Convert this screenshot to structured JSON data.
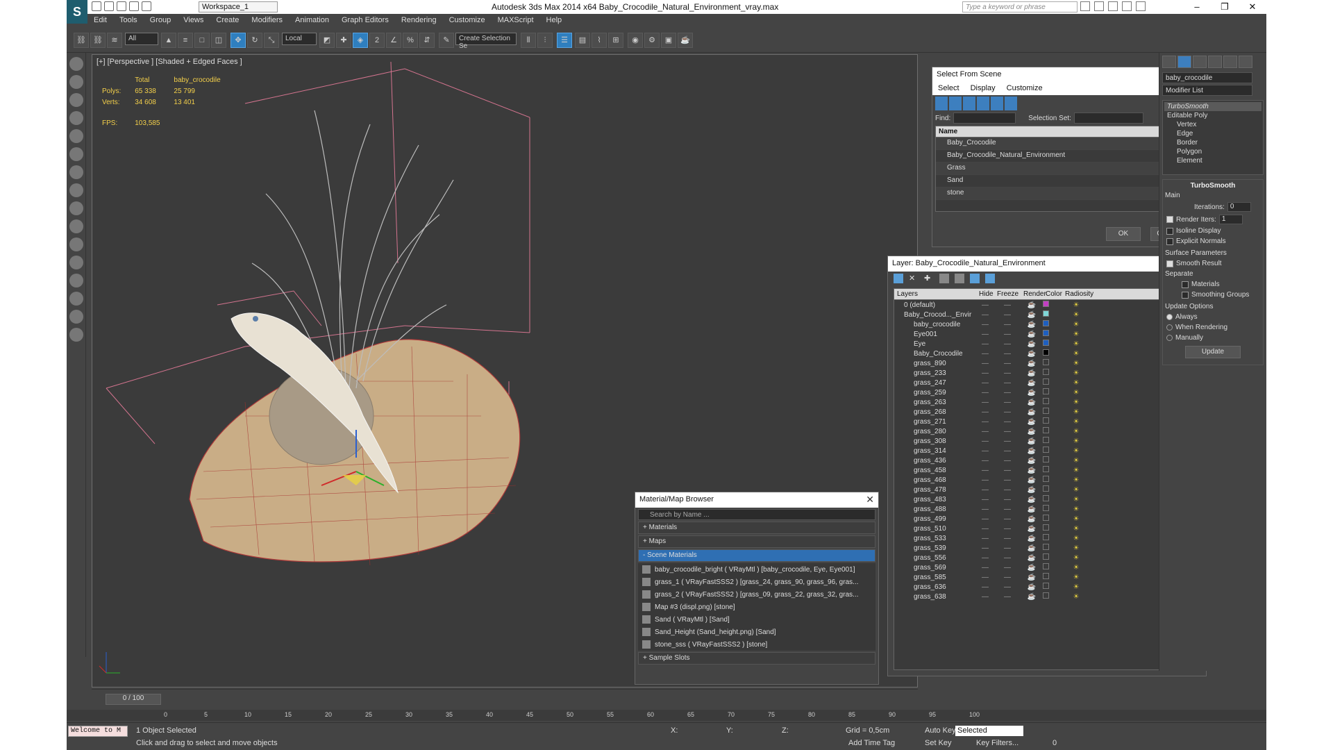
{
  "titlebar": {
    "title": "Autodesk 3ds Max  2014 x64    Baby_Crocodile_Natural_Environment_vray.max",
    "workspace": "Workspace_1",
    "search_placeholder": "Type a keyword or phrase"
  },
  "menu": [
    "Edit",
    "Tools",
    "Group",
    "Views",
    "Create",
    "Modifiers",
    "Animation",
    "Graph Editors",
    "Rendering",
    "Customize",
    "MAXScript",
    "Help"
  ],
  "toolbar": {
    "filter": "All",
    "refcoord": "Local",
    "selset": "Create Selection Se"
  },
  "viewport": {
    "label": "[+] [Perspective ] [Shaded + Edged Faces ]",
    "stats_total": "Total",
    "stats_obj": "baby_crocodile",
    "polys_label": "Polys:",
    "polys_total": "65 338",
    "polys_obj": "25 799",
    "verts_label": "Verts:",
    "verts_total": "34 608",
    "verts_obj": "13 401",
    "fps_label": "FPS:",
    "fps_value": "103,585"
  },
  "select_from_scene": {
    "title": "Select From Scene",
    "menu": [
      "Select",
      "Display",
      "Customize"
    ],
    "find_label": "Find:",
    "selset_label": "Selection Set:",
    "col_name": "Name",
    "items": [
      "Baby_Crocodile",
      "Baby_Crocodile_Natural_Environment",
      "Grass",
      "Sand",
      "stone"
    ],
    "ok": "OK",
    "cancel": "Cancel"
  },
  "layer_dialog": {
    "title": "Layer: Baby_Crocodile_Natural_Environment",
    "help": "?",
    "cols": [
      "Layers",
      "Hide",
      "Freeze",
      "Render",
      "Color",
      "Radiosity"
    ],
    "rows": [
      {
        "name": "0 (default)",
        "indent": 1,
        "color": "#c43fc4"
      },
      {
        "name": "Baby_Crocod..._Envir",
        "indent": 1,
        "color": "#7fd6d6"
      },
      {
        "name": "baby_crocodile",
        "indent": 2,
        "color": "#1e5fbf"
      },
      {
        "name": "Eye001",
        "indent": 2,
        "color": "#1e5fbf"
      },
      {
        "name": "Eye",
        "indent": 2,
        "color": "#1e5fbf"
      },
      {
        "name": "Baby_Crocodile",
        "indent": 2,
        "color": "#000000"
      },
      {
        "name": "grass_890",
        "indent": 2,
        "color": "#3a3a3a"
      },
      {
        "name": "grass_233",
        "indent": 2,
        "color": "#3a3a3a"
      },
      {
        "name": "grass_247",
        "indent": 2,
        "color": "#3a3a3a"
      },
      {
        "name": "grass_259",
        "indent": 2,
        "color": "#3a3a3a"
      },
      {
        "name": "grass_263",
        "indent": 2,
        "color": "#3a3a3a"
      },
      {
        "name": "grass_268",
        "indent": 2,
        "color": "#3a3a3a"
      },
      {
        "name": "grass_271",
        "indent": 2,
        "color": "#3a3a3a"
      },
      {
        "name": "grass_280",
        "indent": 2,
        "color": "#3a3a3a"
      },
      {
        "name": "grass_308",
        "indent": 2,
        "color": "#3a3a3a"
      },
      {
        "name": "grass_314",
        "indent": 2,
        "color": "#3a3a3a"
      },
      {
        "name": "grass_436",
        "indent": 2,
        "color": "#3a3a3a"
      },
      {
        "name": "grass_458",
        "indent": 2,
        "color": "#3a3a3a"
      },
      {
        "name": "grass_468",
        "indent": 2,
        "color": "#3a3a3a"
      },
      {
        "name": "grass_478",
        "indent": 2,
        "color": "#3a3a3a"
      },
      {
        "name": "grass_483",
        "indent": 2,
        "color": "#3a3a3a"
      },
      {
        "name": "grass_488",
        "indent": 2,
        "color": "#3a3a3a"
      },
      {
        "name": "grass_499",
        "indent": 2,
        "color": "#3a3a3a"
      },
      {
        "name": "grass_510",
        "indent": 2,
        "color": "#3a3a3a"
      },
      {
        "name": "grass_533",
        "indent": 2,
        "color": "#3a3a3a"
      },
      {
        "name": "grass_539",
        "indent": 2,
        "color": "#3a3a3a"
      },
      {
        "name": "grass_556",
        "indent": 2,
        "color": "#3a3a3a"
      },
      {
        "name": "grass_569",
        "indent": 2,
        "color": "#3a3a3a"
      },
      {
        "name": "grass_585",
        "indent": 2,
        "color": "#3a3a3a"
      },
      {
        "name": "grass_636",
        "indent": 2,
        "color": "#3a3a3a"
      },
      {
        "name": "grass_638",
        "indent": 2,
        "color": "#3a3a3a"
      }
    ]
  },
  "material_browser": {
    "title": "Material/Map Browser",
    "search_placeholder": "Search by Name ...",
    "sections": [
      "+ Materials",
      "+ Maps",
      "- Scene Materials",
      "+ Sample Slots"
    ],
    "items": [
      "baby_crocodile_bright ( VRayMtl ) [baby_crocodile, Eye, Eye001]",
      "grass_1 ( VRayFastSSS2 ) [grass_24, grass_90, grass_96, gras...",
      "grass_2 ( VRayFastSSS2 ) [grass_09, grass_22, grass_32, gras...",
      "Map #3 (displ.png) [stone]",
      "Sand ( VRayMtl ) [Sand]",
      "Sand_Height (Sand_height.png) [Sand]",
      "stone_sss ( VRayFastSSS2 ) [stone]"
    ]
  },
  "command_panel": {
    "object_name": "baby_crocodile",
    "modifier_list": "Modifier List",
    "stack": [
      "TurboSmooth",
      "Editable Poly",
      "Vertex",
      "Edge",
      "Border",
      "Polygon",
      "Element"
    ],
    "rollout_title": "TurboSmooth",
    "main": "Main",
    "iterations_label": "Iterations:",
    "iterations": "0",
    "render_iters_label": "Render Iters:",
    "render_iters": "1",
    "isoline": "Isoline Display",
    "explicit": "Explicit Normals",
    "surface": "Surface Parameters",
    "smooth": "Smooth Result",
    "separate": "Separate",
    "materials": "Materials",
    "smoothing": "Smoothing Groups",
    "update_opts": "Update Options",
    "always": "Always",
    "when_rendering": "When Rendering",
    "manually": "Manually",
    "update": "Update"
  },
  "timeline": {
    "frame": "0 / 100",
    "ticks": [
      "0",
      "5",
      "10",
      "15",
      "20",
      "25",
      "30",
      "35",
      "40",
      "45",
      "50",
      "55",
      "60",
      "65",
      "70",
      "75",
      "80",
      "85",
      "90",
      "95",
      "100"
    ]
  },
  "status": {
    "welcome": "Welcome to M",
    "selected": "1 Object Selected",
    "hint": "Click and drag to select and move objects",
    "x_label": "X:",
    "y_label": "Y:",
    "z_label": "Z:",
    "grid": "Grid = 0,5cm",
    "autokey": "Auto Key",
    "setkey": "Set Key",
    "selected_dd": "Selected",
    "keyfilters": "Key Filters...",
    "add_time_tag": "Add Time Tag",
    "frame_val": "0"
  }
}
